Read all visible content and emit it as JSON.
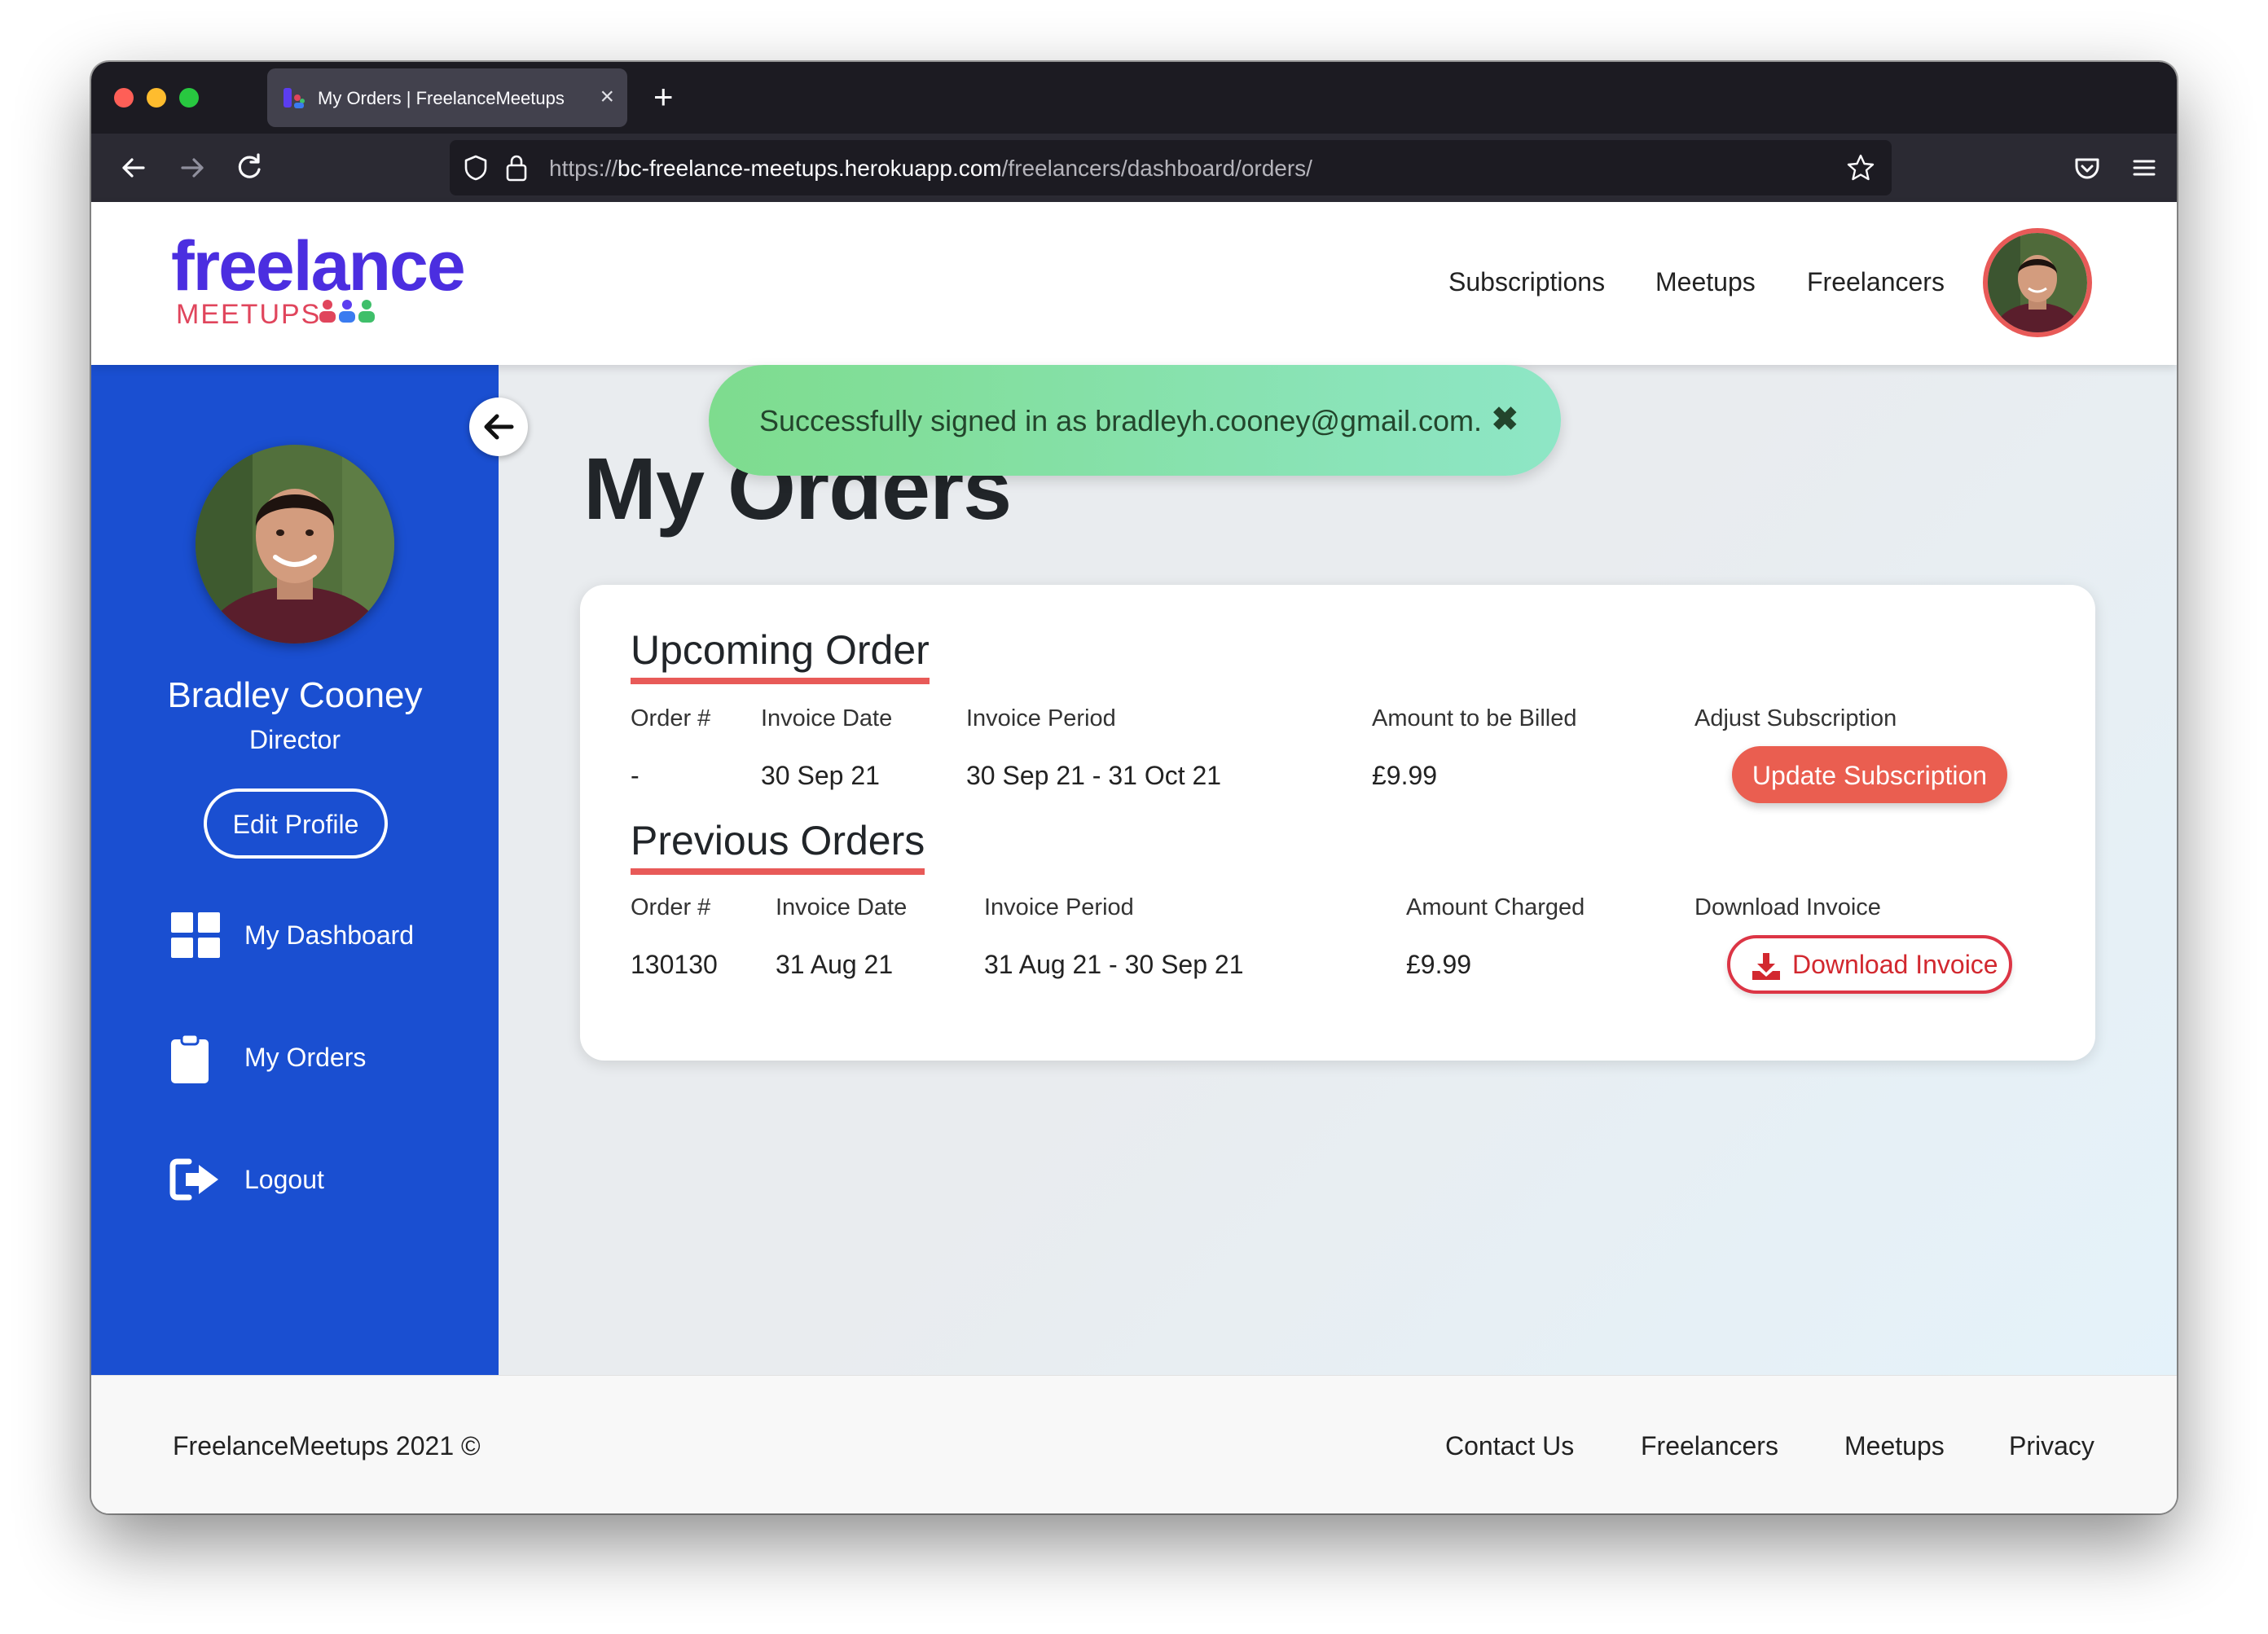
{
  "browser": {
    "tab_title": "My Orders | FreelanceMeetups",
    "tab_close": "×",
    "new_tab": "+",
    "url_scheme": "https://",
    "url_host": "bc-freelance-meetups.herokuapp.com",
    "url_path": "/freelancers/dashboard/orders/"
  },
  "header": {
    "logo_main": "freelance",
    "logo_sub": "MEETUPS",
    "nav": [
      "Subscriptions",
      "Meetups",
      "Freelancers"
    ]
  },
  "alert": {
    "message": "Successfully signed in as bradleyh.cooney@gmail.com.",
    "close": "✖"
  },
  "sidebar": {
    "name": "Bradley Cooney",
    "role": "Director",
    "edit_profile": "Edit Profile",
    "items": [
      {
        "label": "My Dashboard",
        "icon": "grid-icon"
      },
      {
        "label": "My Orders",
        "icon": "clipboard-icon"
      },
      {
        "label": "Logout",
        "icon": "logout-icon"
      }
    ]
  },
  "main": {
    "title": "My Orders",
    "upcoming": {
      "title": "Upcoming Order",
      "headers": [
        "Order #",
        "Invoice Date",
        "Invoice Period",
        "Amount to be Billed",
        "Adjust Subscription"
      ],
      "row": [
        "-",
        "30 Sep 21",
        "30 Sep 21 - 31 Oct 21",
        "£9.99"
      ],
      "button": "Update Subscription"
    },
    "previous": {
      "title": "Previous Orders",
      "headers": [
        "Order #",
        "Invoice Date",
        "Invoice Period",
        "Amount Charged",
        "Download Invoice"
      ],
      "row": [
        "130130",
        "31 Aug 21",
        "31 Aug 21 - 30 Sep 21",
        "£9.99"
      ],
      "button": "Download Invoice"
    }
  },
  "footer": {
    "copyright": "FreelanceMeetups 2021 ©",
    "links": [
      "Contact Us",
      "Freelancers",
      "Meetups",
      "Privacy"
    ]
  },
  "colors": {
    "brand": "#4b2ee0",
    "sidebar": "#1a4fd1",
    "accent": "#e85a58",
    "success": "#7edc8e"
  }
}
